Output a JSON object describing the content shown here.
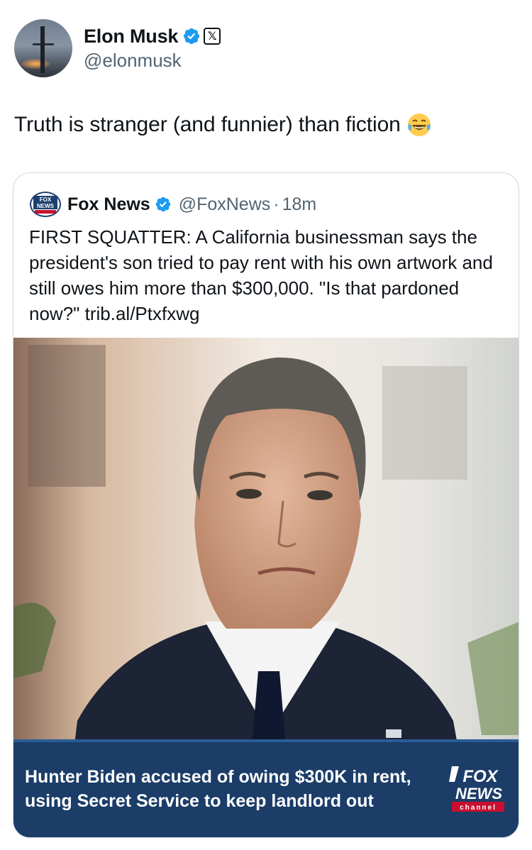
{
  "author": {
    "name": "Elon Musk",
    "handle": "@elonmusk",
    "avatar_icon": "starship-avatar",
    "verified_icon": "verified-badge-icon",
    "affiliation_icon": "x-logo-icon"
  },
  "tweet": {
    "text": "Truth is stranger (and funnier) than fiction",
    "emoji_icon": "face-with-tears-of-joy-icon"
  },
  "quoted_tweet": {
    "name": "Fox News",
    "handle": "@FoxNews",
    "separator": "·",
    "time": "18m",
    "text": "FIRST SQUATTER: A California businessman says the president's son tried to pay rent with his own artwork and still owes him more than $300,000. \"Is that pardoned now?\" trib.al/Ptxfxwg",
    "logo_icon": "fox-news-logo-icon",
    "logo_text": "FOX NEWS channel"
  },
  "media": {
    "headline": "Hunter Biden accused of owing $300K in rent, using Secret Service to keep landlord out",
    "logo_text": "FOX NEWS channel"
  },
  "colors": {
    "text": "#0f1419",
    "secondary": "#536471",
    "verified_blue": "#1d9bf0",
    "border": "#cfd9de",
    "banner_blue": "#1b3d68"
  }
}
